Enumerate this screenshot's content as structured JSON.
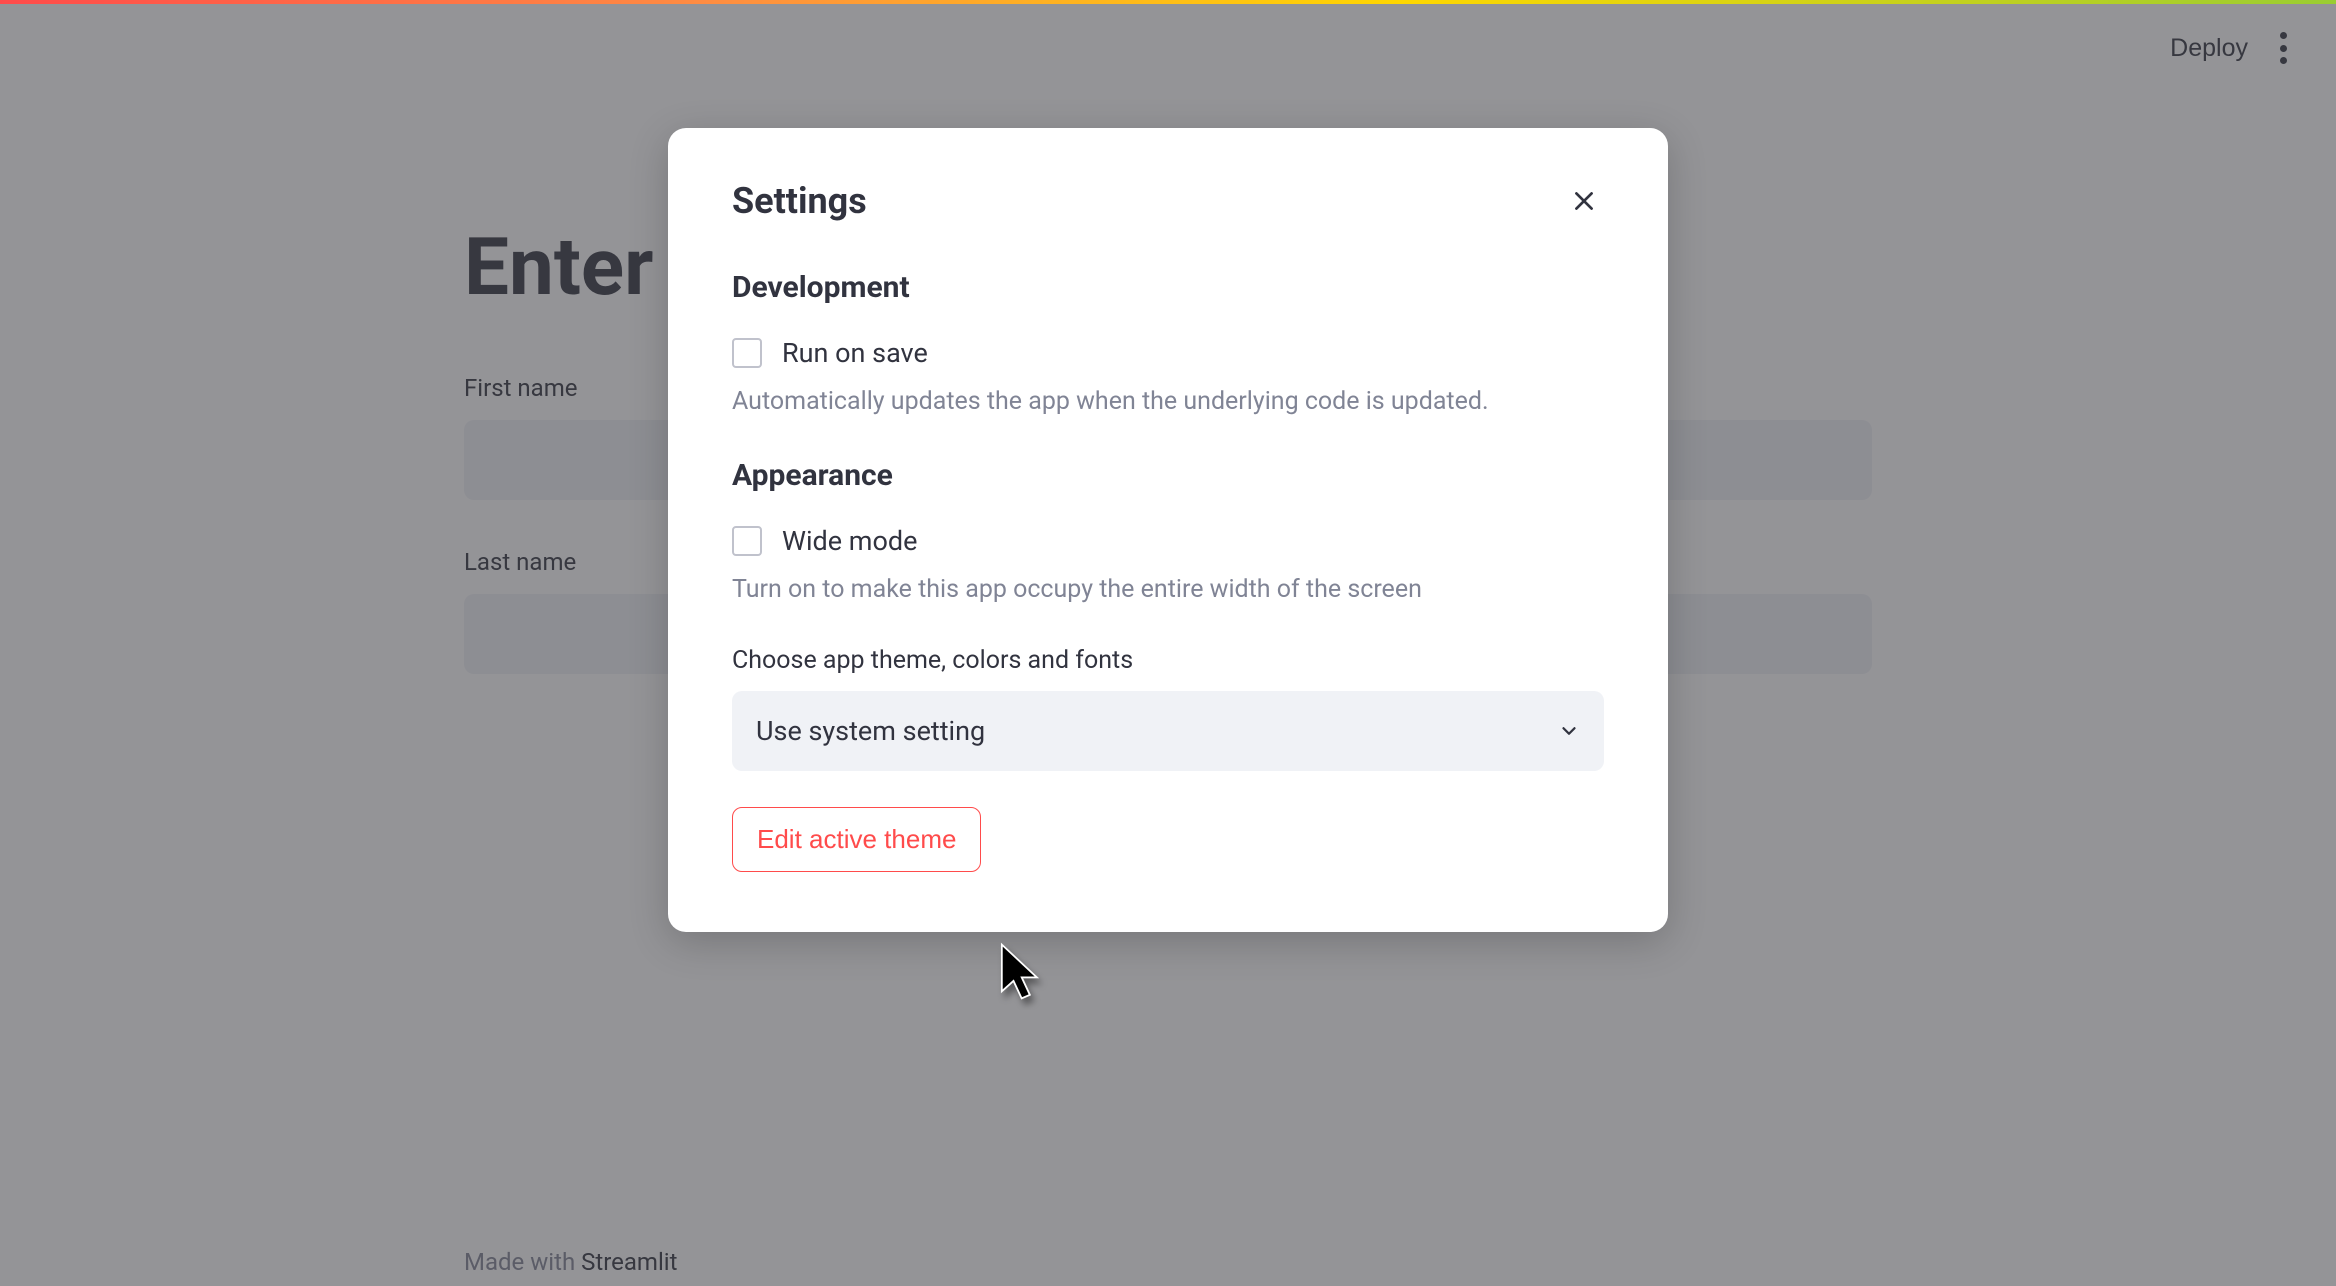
{
  "header": {
    "deploy_label": "Deploy"
  },
  "page": {
    "title_visible_fragment": "Enter",
    "first_name_label": "First name",
    "last_name_label": "Last name",
    "first_name_value": "",
    "last_name_value": ""
  },
  "footer": {
    "prefix": "Made with ",
    "brand": "Streamlit"
  },
  "modal": {
    "title": "Settings",
    "sections": {
      "development": {
        "heading": "Development",
        "run_on_save_label": "Run on save",
        "run_on_save_help": "Automatically updates the app when the underlying code is updated.",
        "run_on_save_checked": false
      },
      "appearance": {
        "heading": "Appearance",
        "wide_mode_label": "Wide mode",
        "wide_mode_help": "Turn on to make this app occupy the entire width of the screen",
        "wide_mode_checked": false,
        "theme_label": "Choose app theme, colors and fonts",
        "theme_selected": "Use system setting",
        "edit_theme_label": "Edit active theme"
      }
    }
  },
  "colors": {
    "accent_red": "#ff4b4b",
    "text_primary": "#31333f",
    "text_secondary": "#808495",
    "input_bg": "#f0f2f6"
  }
}
